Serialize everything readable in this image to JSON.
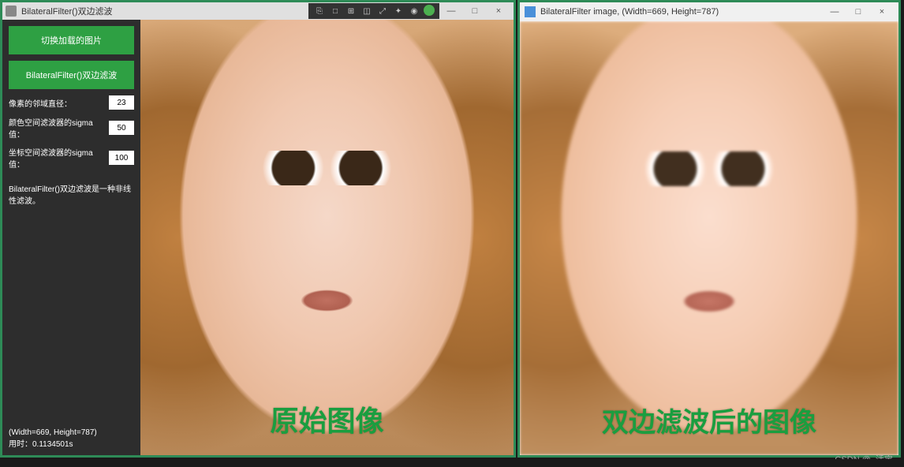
{
  "left_window": {
    "title": "BilateralFilter()双边滤波",
    "toolbar_icons": [
      "tool-a",
      "tool-b",
      "tool-c",
      "tool-d",
      "tool-e",
      "tool-f",
      "tool-g",
      "tool-check"
    ],
    "sidebar": {
      "btn_switch": "切换加载的图片",
      "btn_filter": "BilateralFilter()双边滤波",
      "params": [
        {
          "label": "像素的邻域直径：",
          "value": "23"
        },
        {
          "label": "颜色空间滤波器的sigma值：",
          "value": "50"
        },
        {
          "label": "坐标空间滤波器的sigma值：",
          "value": "100"
        }
      ],
      "desc": "BilateralFilter()双边滤波是一种非线性滤波。",
      "size_info": "(Width=669, Height=787)",
      "timing_label": "用时：",
      "timing_value": "0.1134501s"
    },
    "overlay": "原始图像"
  },
  "right_window": {
    "title": "BilateralFilter image, (Width=669, Height=787)",
    "overlay": "双边滤波后的图像"
  },
  "window_controls": {
    "min": "—",
    "max": "□",
    "close": "×"
  },
  "watermark": "CSDN @..活宝.."
}
